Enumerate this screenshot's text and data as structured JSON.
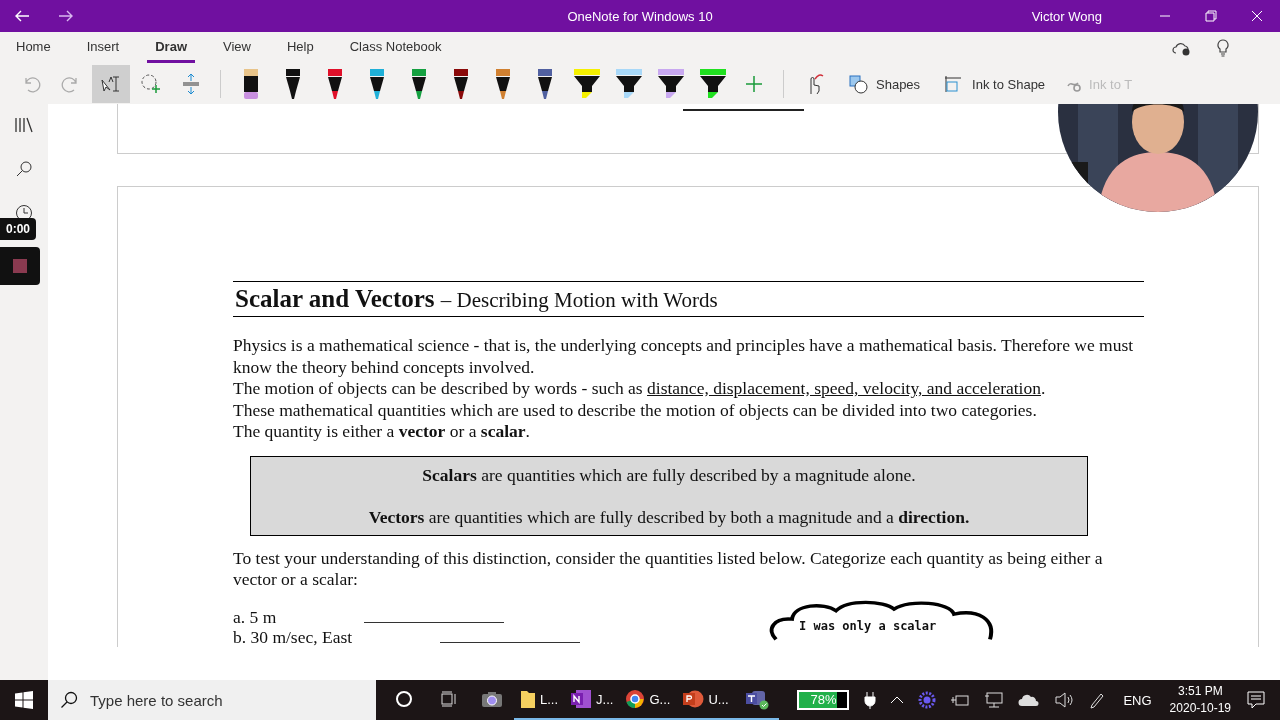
{
  "window": {
    "title": "OneNote for Windows 10",
    "user": "Victor Wong"
  },
  "ribbon_tabs": [
    {
      "label": "Home",
      "selected": false
    },
    {
      "label": "Insert",
      "selected": false
    },
    {
      "label": "Draw",
      "selected": true
    },
    {
      "label": "View",
      "selected": false
    },
    {
      "label": "Help",
      "selected": false
    },
    {
      "label": "Class Notebook",
      "selected": false
    }
  ],
  "tools": [
    {
      "kind": "undo",
      "disabled": true
    },
    {
      "kind": "redo",
      "disabled": true
    },
    {
      "kind": "lasso-type",
      "selected": true
    },
    {
      "kind": "lasso",
      "selected": false
    },
    {
      "kind": "space",
      "selected": false
    }
  ],
  "pens": [
    {
      "kind": "eraser",
      "color": "#e8c48a"
    },
    {
      "kind": "pen",
      "color": "#111111"
    },
    {
      "kind": "pen",
      "color": "#e0102a"
    },
    {
      "kind": "pen",
      "color": "#1fb0d8"
    },
    {
      "kind": "pen",
      "color": "#14a040"
    },
    {
      "kind": "pen",
      "color": "#8a0a0a"
    },
    {
      "kind": "pen",
      "color": "#d08030"
    },
    {
      "kind": "pen",
      "color": "#5060a0"
    },
    {
      "kind": "highlighter",
      "color": "#f5f000"
    },
    {
      "kind": "highlighter",
      "color": "#a8d8f8"
    },
    {
      "kind": "highlighter",
      "color": "#c8a8f0"
    },
    {
      "kind": "highlighter",
      "color": "#20e020"
    }
  ],
  "actions": [
    {
      "label": "Shapes",
      "disabled": false
    },
    {
      "label": "Ink to Shape",
      "disabled": false
    },
    {
      "label": "Ink to T",
      "disabled": true
    }
  ],
  "recorder": {
    "time": "0:00"
  },
  "document": {
    "heading_bold": "Scalar and Vectors",
    "heading_rest": "– Describing Motion with Words",
    "lines": [
      {
        "parts": [
          {
            "text": "Physics is a mathematical science - that is, the underlying concepts and principles have a mathematical basis. Therefore we must know the theory behind concepts involved.",
            "underlined": false
          }
        ]
      },
      {
        "parts": [
          {
            "text": "The motion of objects can be described by words - such as ",
            "underlined": false
          },
          {
            "text": "distance, displacement, speed, velocity, and acceleration",
            "underlined": true
          },
          {
            "text": ".",
            "underlined": false
          }
        ]
      },
      {
        "parts": [
          {
            "text": "These mathematical quantities which are used to describe the motion of objects can be divided into two categories.",
            "underlined": false
          }
        ]
      },
      {
        "parts": [
          {
            "text": "The quantity is either a **vector** or a **scalar**.",
            "underlined": false
          }
        ]
      }
    ],
    "definitions": [
      "**Scalars** are quantities which are fully described by a magnitude alone.",
      "**Vectors** are quantities which are fully described by both a magnitude and a **direction.**"
    ],
    "instruction": "To test your understanding of this distinction, consider the quantities listed below. Categorize each quantity as being either a vector or a scalar:",
    "items": [
      "a. 5 m",
      "b. 30 m/sec, East"
    ],
    "cloud_text": "I was only a scalar"
  },
  "taskbar": {
    "search_placeholder": "Type here to search",
    "apps": [
      {
        "kind": "cortana",
        "running": false
      },
      {
        "kind": "taskview",
        "running": false
      },
      {
        "kind": "camera",
        "running": false
      },
      {
        "kind": "folder",
        "label": "L...",
        "running": true
      },
      {
        "kind": "onenote",
        "label": "J...",
        "running": true
      },
      {
        "kind": "chrome",
        "label": "G...",
        "running": true
      },
      {
        "kind": "powerpoint",
        "label": "U...",
        "running": true
      },
      {
        "kind": "teams",
        "running": true
      }
    ],
    "battery": {
      "reading": "78%",
      "level": 0.78
    },
    "language": "ENG",
    "time": "3:51 PM",
    "date": "2020-10-19"
  }
}
